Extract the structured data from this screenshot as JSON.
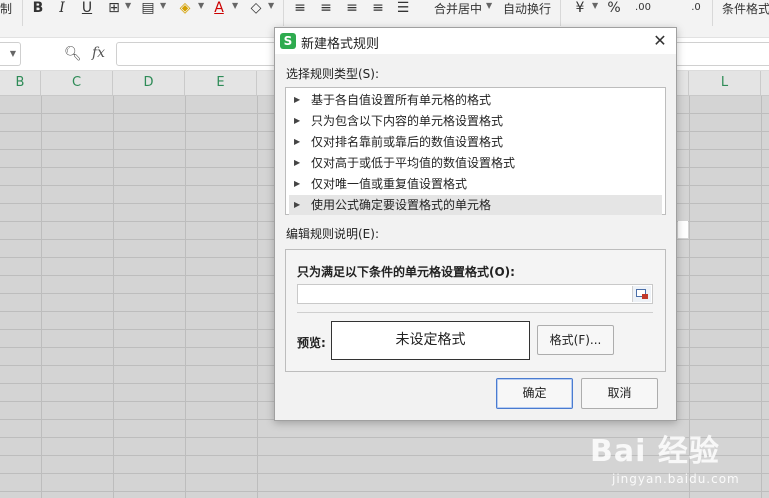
{
  "ribbon": {
    "left_fragment": "制",
    "bold": "B",
    "italic": "I",
    "underline": "U",
    "font_color_letter": "A",
    "merge_center": "合并居中",
    "wrap_text": "自动换行",
    "percent": "%",
    "inc_decimal": ".00",
    "dec_decimal": ".0",
    "conditional_format": "条件格式"
  },
  "formula_bar": {
    "fx": "fx"
  },
  "columns": [
    "B",
    "C",
    "D",
    "E",
    "L"
  ],
  "watermark": {
    "logo": "Bai 经验",
    "url": "jingyan.baidu.com"
  },
  "dialog": {
    "title": "新建格式规则",
    "app_icon": "S",
    "close": "✕",
    "rule_type_label": "选择规则类型(S):",
    "rule_types": [
      "基于各自值设置所有单元格的格式",
      "只为包含以下内容的单元格设置格式",
      "仅对排名靠前或靠后的数值设置格式",
      "仅对高于或低于平均值的数值设置格式",
      "仅对唯一值或重复值设置格式",
      "使用公式确定要设置格式的单元格"
    ],
    "selected_index": 5,
    "edit_desc_label": "编辑规则说明(E):",
    "condition_label": "只为满足以下条件的单元格设置格式(O):",
    "formula_value": "",
    "preview_label": "预览:",
    "preview_text": "未设定格式",
    "format_button": "格式(F)...",
    "ok_button": "确定",
    "cancel_button": "取消"
  }
}
